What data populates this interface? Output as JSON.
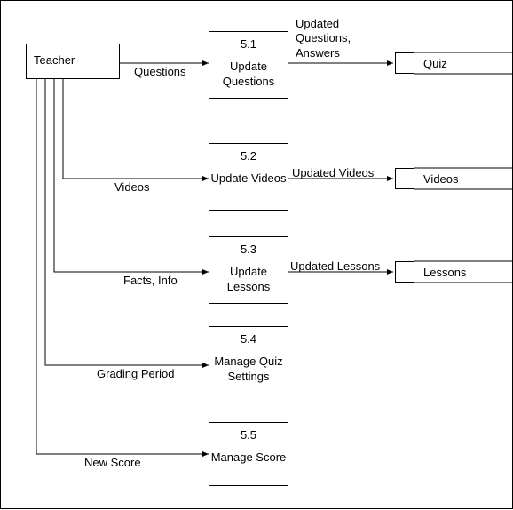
{
  "entity": {
    "name": "Teacher"
  },
  "processes": [
    {
      "num": "5.1",
      "name": "Update\nQuestions"
    },
    {
      "num": "5.2",
      "name": "Update\nVideos"
    },
    {
      "num": "5.3",
      "name": "Update\nLessons"
    },
    {
      "num": "5.4",
      "name": "Manage\nQuiz\nSettings"
    },
    {
      "num": "5.5",
      "name": "Manage\nScore"
    }
  ],
  "datastores": [
    {
      "name": "Quiz"
    },
    {
      "name": "Videos"
    },
    {
      "name": "Lessons"
    }
  ],
  "flows": {
    "to_p1": "Questions",
    "to_p2": "Videos",
    "to_p3": "Facts, Info",
    "to_p4": "Grading Period",
    "to_p5": "New Score",
    "out_p1": "Updated\nQuestions,\nAnswers",
    "out_p2": "Updated Videos",
    "out_p3": "Updated Lessons"
  }
}
